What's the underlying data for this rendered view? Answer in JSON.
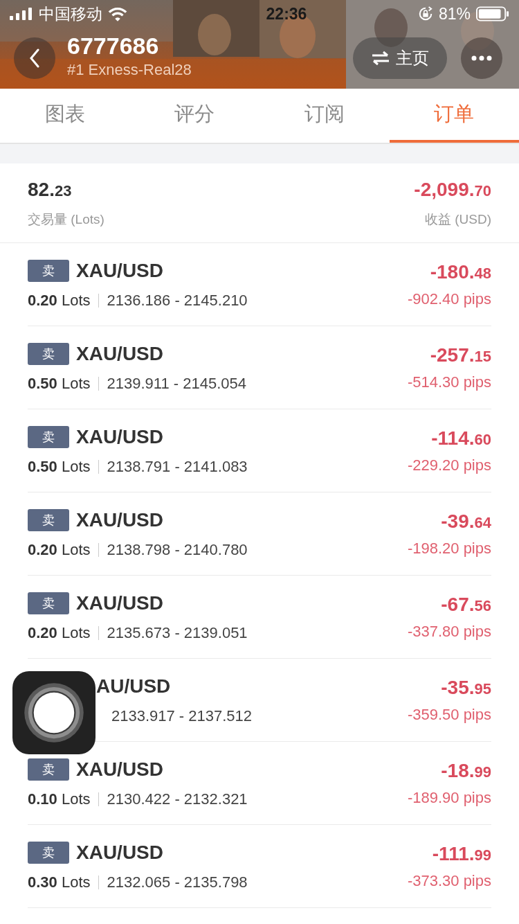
{
  "status_bar": {
    "carrier": "中国移动",
    "time": "22:36",
    "battery": "81%"
  },
  "header": {
    "title": "6777686",
    "subtitle": "#1 Exness-Real28",
    "home_button": "主页"
  },
  "tabs": [
    {
      "label": "图表",
      "selected": false
    },
    {
      "label": "评分",
      "selected": false
    },
    {
      "label": "订阅",
      "selected": false
    },
    {
      "label": "订单",
      "selected": true
    }
  ],
  "summary": {
    "volume": "82.23",
    "volume_label": "交易量 (Lots)",
    "profit": "-2,099.70",
    "profit_label": "收益 (USD)"
  },
  "orders": [
    {
      "side": "卖",
      "symbol": "XAU/USD",
      "lots": "**0.20** Lots",
      "prices": "2136.186 - 2145.210",
      "profit": "-180.48",
      "pips": "-902.40 pips"
    },
    {
      "side": "卖",
      "symbol": "XAU/USD",
      "lots": "**0.50** Lots",
      "prices": "2139.911 - 2145.054",
      "profit": "-257.15",
      "pips": "-514.30 pips"
    },
    {
      "side": "卖",
      "symbol": "XAU/USD",
      "lots": "**0.50** Lots",
      "prices": "2138.791 - 2141.083",
      "profit": "-114.60",
      "pips": "-229.20 pips"
    },
    {
      "side": "卖",
      "symbol": "XAU/USD",
      "lots": "**0.20** Lots",
      "prices": "2138.798 - 2140.780",
      "profit": "-39.64",
      "pips": "-198.20 pips"
    },
    {
      "side": "卖",
      "symbol": "XAU/USD",
      "lots": "**0.20** Lots",
      "prices": "2135.673 - 2139.051",
      "profit": "-67.56",
      "pips": "-337.80 pips"
    },
    {
      "symbol": "AU/USD",
      "prices": "2133.917 - 2137.512",
      "profit": "-35.95",
      "pips": "-359.50 pips"
    },
    {
      "side": "卖",
      "symbol": "XAU/USD",
      "lots": "**0.10** Lots",
      "prices": "2130.422 - 2132.321",
      "profit": "-18.99",
      "pips": "-189.90 pips"
    },
    {
      "side": "卖",
      "symbol": "XAU/USD",
      "lots": "**0.30** Lots",
      "prices": "2132.065 - 2135.798",
      "profit": "-111.99",
      "pips": "-373.30 pips"
    }
  ]
}
